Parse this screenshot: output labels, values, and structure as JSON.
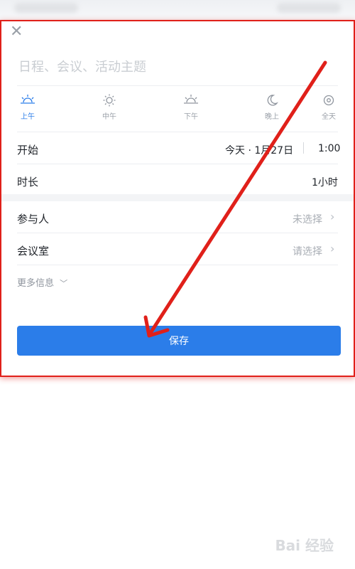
{
  "title": {
    "placeholder": "日程、会议、活动主题"
  },
  "periods": [
    {
      "label": "上午",
      "icon": "sunrise-icon",
      "active": true
    },
    {
      "label": "中午",
      "icon": "sun-icon"
    },
    {
      "label": "下午",
      "icon": "sunset-icon"
    },
    {
      "label": "晚上",
      "icon": "moon-icon"
    },
    {
      "label": "全天",
      "icon": "all-day-icon"
    }
  ],
  "start": {
    "label": "开始",
    "date": "今天 · 1月27日",
    "time": "1:00"
  },
  "duration": {
    "label": "时长",
    "value": "1小时"
  },
  "participants": {
    "label": "参与人",
    "value": "未选择"
  },
  "room": {
    "label": "会议室",
    "value": "请选择"
  },
  "more": {
    "label": "更多信息"
  },
  "save": {
    "label": "保存"
  },
  "watermark": {
    "text": "Bai 经验"
  },
  "colors": {
    "accent": "#2b7de9",
    "annotation": "#e0201a"
  }
}
